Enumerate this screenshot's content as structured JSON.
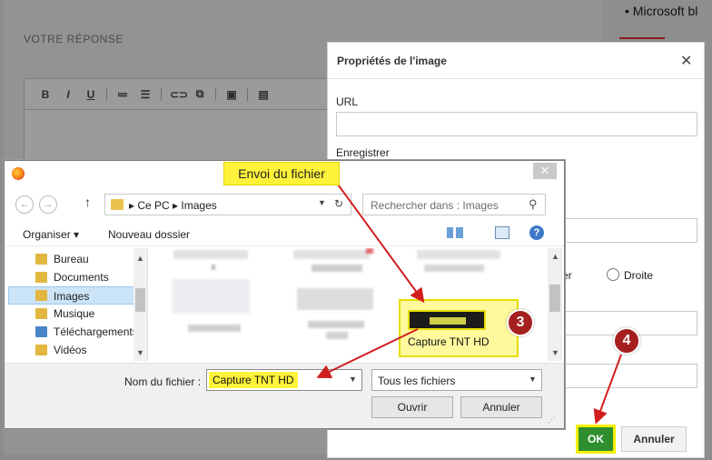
{
  "background_page": {
    "reply_title": "VOTRE RÉPONSE",
    "toolbar": [
      "B",
      "I",
      "U",
      "≔",
      "☰",
      "⊂⊃",
      "⧉",
      "▣",
      "▤"
    ],
    "sidebar_bullet": "• Microsoft bl"
  },
  "image_dialog": {
    "title": "Propriétés de l'image",
    "close": "✕",
    "url_label": "URL",
    "save_label": "Enregistrer",
    "align_partial": "er",
    "align_right": "Droite",
    "ok": "OK",
    "cancel": "Annuler"
  },
  "file_dialog": {
    "close": "✕",
    "path": "Ce PC  ▸  Images",
    "path_parts": [
      "Ce PC",
      "Images"
    ],
    "search_placeholder": "Rechercher dans : Images",
    "organize": "Organiser ▾",
    "new_folder": "Nouveau dossier",
    "sidebar": [
      "Bureau",
      "Documents",
      "Images",
      "Musique",
      "Téléchargements",
      "Vidéos"
    ],
    "selected_sidebar": "Images",
    "selected_file": "Capture TNT HD",
    "filename_label": "Nom du fichier :",
    "filename_value": "Capture TNT HD",
    "filetype": "Tous les fichiers",
    "open": "Ouvrir",
    "cancel": "Annuler"
  },
  "annotations": {
    "callout": "Envoi du fichier",
    "step3": "3",
    "step4": "4"
  },
  "colors": {
    "highlight": "#fff23a",
    "annotation_red": "#a61f1f",
    "ok_green": "#2f8f2f"
  }
}
